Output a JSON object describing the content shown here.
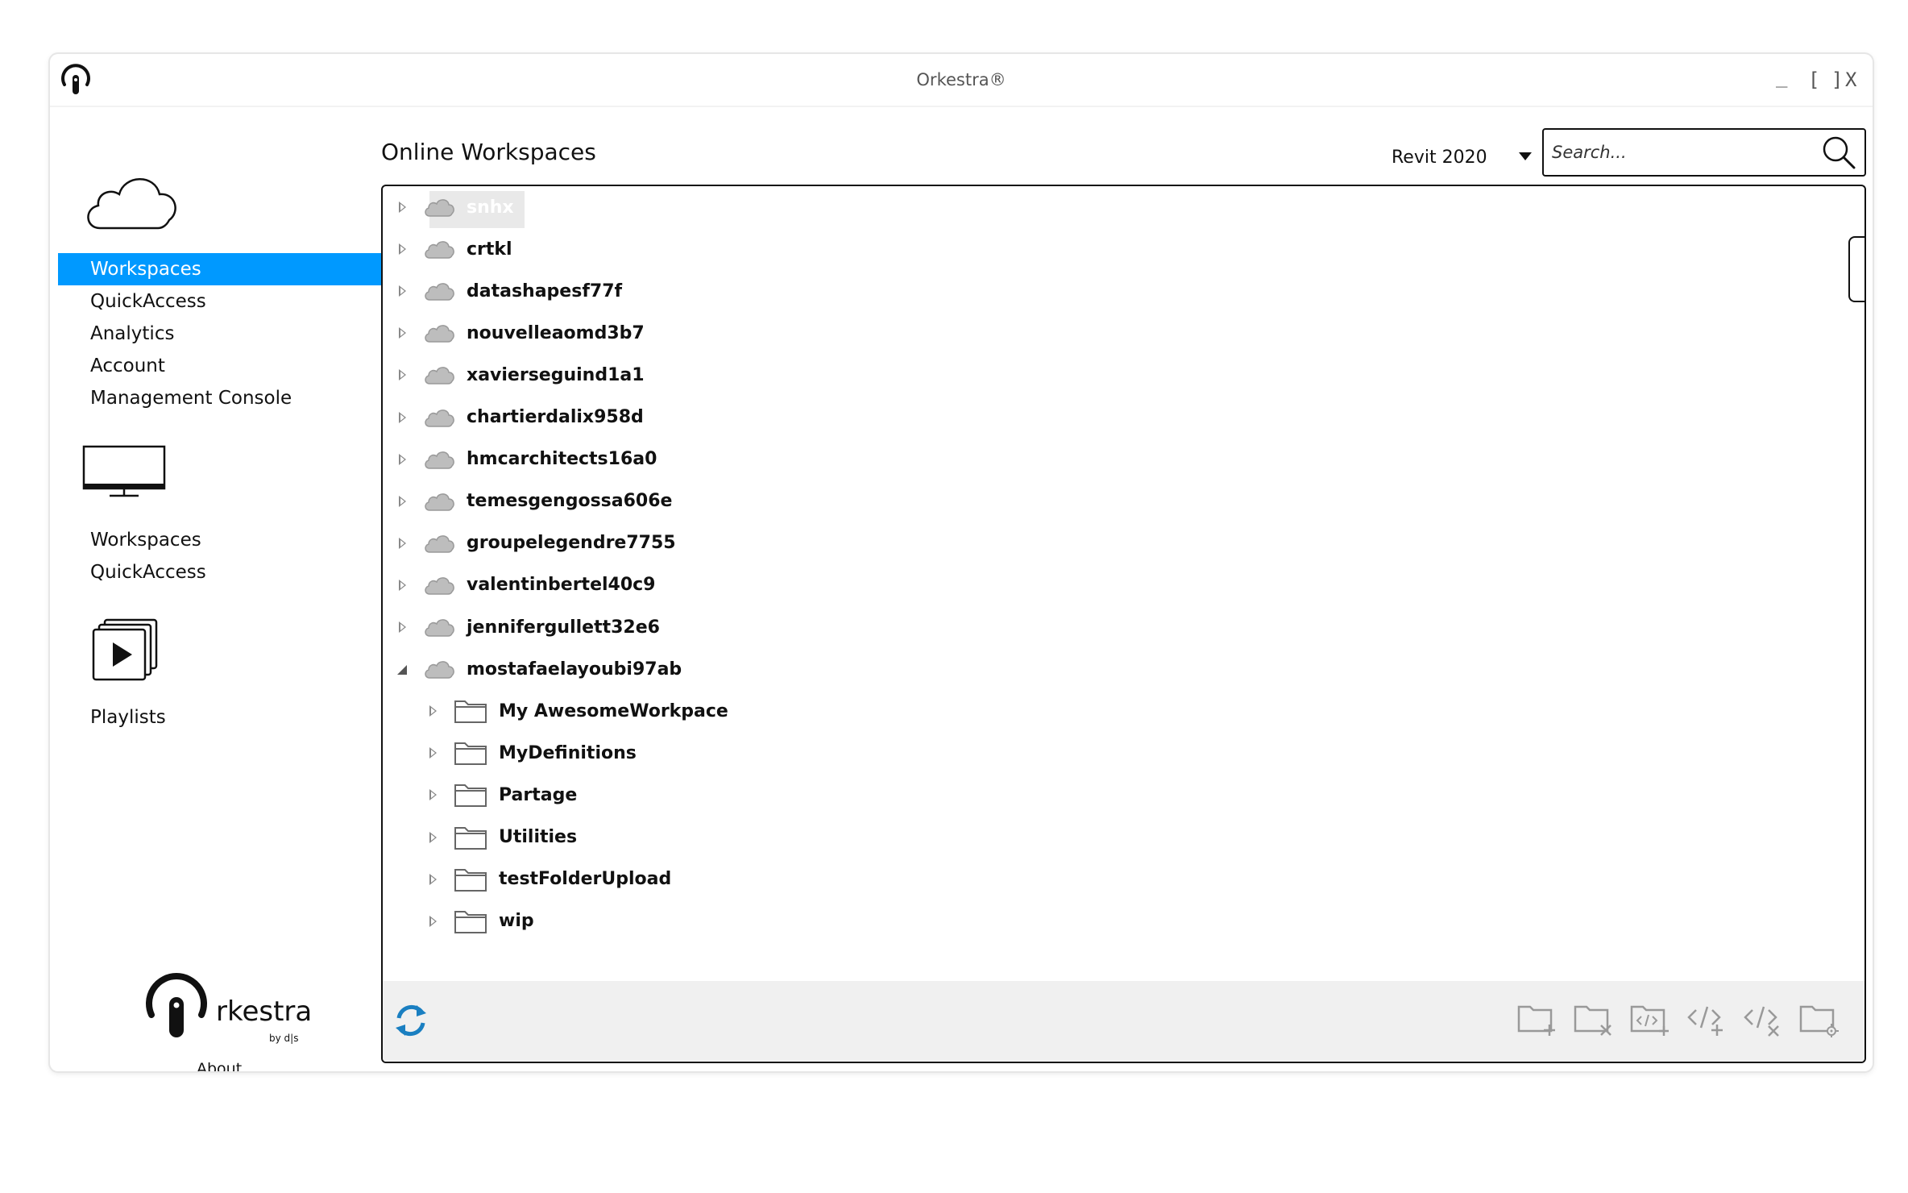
{
  "window": {
    "title": "Orkestra®",
    "minimize_label": "_",
    "maximize_label": "[ ]",
    "close_label": "X"
  },
  "sidebar": {
    "online_items": [
      {
        "label": "Workspaces"
      },
      {
        "label": "QuickAccess"
      },
      {
        "label": "Analytics"
      },
      {
        "label": "Account"
      },
      {
        "label": "Management Console"
      }
    ],
    "local_items": [
      {
        "label": "Workspaces"
      },
      {
        "label": "QuickAccess"
      }
    ],
    "playlist_items": [
      {
        "label": "Playlists"
      }
    ],
    "logo_text": "rkestra",
    "logo_sub": "by d|s",
    "about_label": "About"
  },
  "main": {
    "title": "Online Workspaces",
    "version": "Revit 2020",
    "search_placeholder": "Search...",
    "tree": [
      {
        "label": "snhx",
        "type": "cloud",
        "expanded": false,
        "level": 0,
        "selected": true
      },
      {
        "label": "crtkl",
        "type": "cloud",
        "expanded": false,
        "level": 0
      },
      {
        "label": "datashapesf77f",
        "type": "cloud",
        "expanded": false,
        "level": 0
      },
      {
        "label": "nouvelleaomd3b7",
        "type": "cloud",
        "expanded": false,
        "level": 0
      },
      {
        "label": "xavierseguind1a1",
        "type": "cloud",
        "expanded": false,
        "level": 0
      },
      {
        "label": "chartierdalix958d",
        "type": "cloud",
        "expanded": false,
        "level": 0
      },
      {
        "label": "hmcarchitects16a0",
        "type": "cloud",
        "expanded": false,
        "level": 0
      },
      {
        "label": "temesgengossa606e",
        "type": "cloud",
        "expanded": false,
        "level": 0
      },
      {
        "label": "groupelegendre7755",
        "type": "cloud",
        "expanded": false,
        "level": 0
      },
      {
        "label": "valentinbertel40c9",
        "type": "cloud",
        "expanded": false,
        "level": 0
      },
      {
        "label": "jennifergullett32e6",
        "type": "cloud",
        "expanded": false,
        "level": 0
      },
      {
        "label": "mostafaelayoubi97ab",
        "type": "cloud",
        "expanded": true,
        "level": 0
      },
      {
        "label": "My AwesomeWorkpace",
        "type": "folder",
        "expanded": false,
        "level": 1
      },
      {
        "label": "MyDefinitions",
        "type": "folder",
        "expanded": false,
        "level": 1
      },
      {
        "label": "Partage",
        "type": "folder",
        "expanded": false,
        "level": 1
      },
      {
        "label": "Utilities",
        "type": "folder",
        "expanded": false,
        "level": 1
      },
      {
        "label": "testFolderUpload",
        "type": "folder",
        "expanded": false,
        "level": 1
      },
      {
        "label": "wip",
        "type": "folder",
        "expanded": false,
        "level": 1
      }
    ],
    "toolbar_icons": [
      "refresh-icon",
      "add-folder-icon",
      "delete-folder-icon",
      "add-script-folder-icon",
      "add-script-icon",
      "delete-script-icon",
      "folder-settings-icon"
    ]
  },
  "colors": {
    "accent": "#0099ff",
    "refresh": "#1a7fc1",
    "icon_gray": "#999999"
  }
}
